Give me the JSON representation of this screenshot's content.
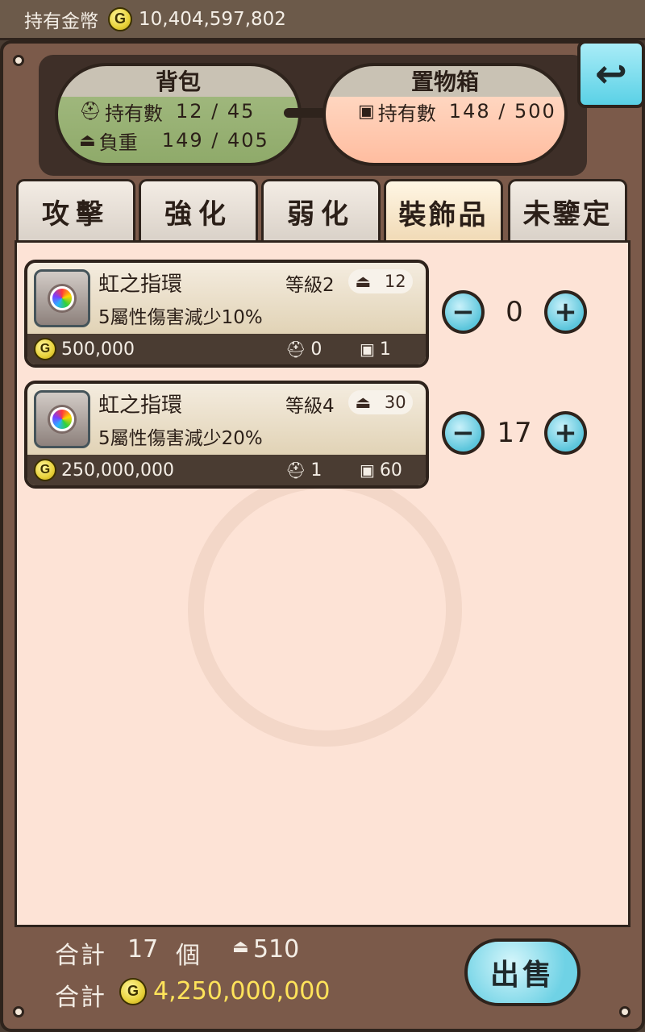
{
  "topbar": {
    "label": "持有金幣",
    "coin_icon": "G",
    "gold": "10,404,597,802"
  },
  "bag": {
    "title": "背包",
    "count_label": "持有數",
    "count": "12  /  45",
    "weight_label": "負重",
    "weight": "149  /  405"
  },
  "box": {
    "title": "置物箱",
    "count_label": "持有數",
    "count": "148  /  500"
  },
  "tabs": [
    {
      "label": "攻擊"
    },
    {
      "label": "強化"
    },
    {
      "label": "弱化"
    },
    {
      "label": "裝飾品"
    },
    {
      "label": "未鑒定"
    }
  ],
  "items": [
    {
      "name": "虹之指環",
      "level": "等級2",
      "weight": "12",
      "desc": "5屬性傷害減少10%",
      "price": "500,000",
      "bag_count": "0",
      "box_count": "1",
      "qty": "0"
    },
    {
      "name": "虹之指環",
      "level": "等級4",
      "weight": "30",
      "desc": "5屬性傷害減少20%",
      "price": "250,000,000",
      "bag_count": "1",
      "box_count": "60",
      "qty": "17"
    }
  ],
  "footer": {
    "total_label": "合計",
    "count": "17",
    "unit": "個",
    "weight": "510",
    "gold_total": "4,250,000,000",
    "sell_label": "出售"
  },
  "icons": {
    "minus": "−",
    "plus": "+",
    "back": "↩"
  },
  "colors": {
    "accent_blue": "#5cc6dc",
    "gold_text": "#ffe35a",
    "panel_bg": "#fde3d6"
  }
}
